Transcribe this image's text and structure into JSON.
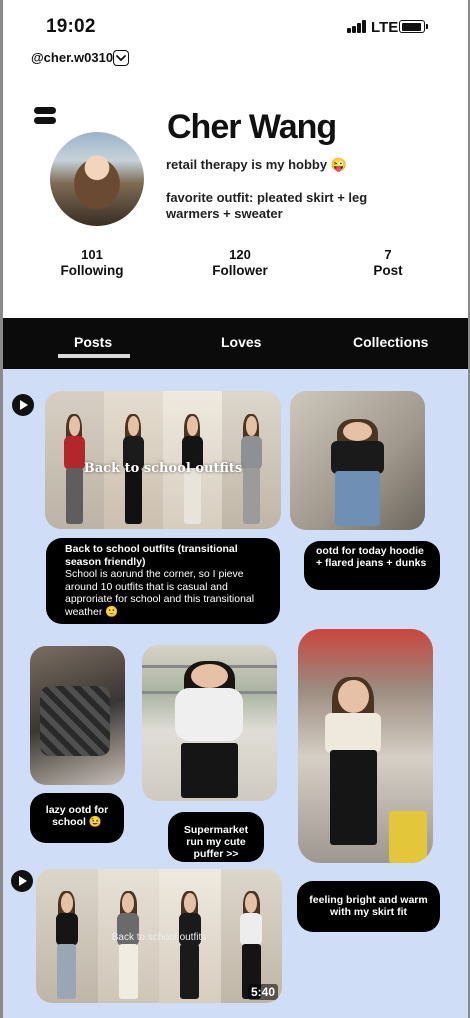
{
  "status_bar": {
    "time": "19:02",
    "network": "LTE"
  },
  "profile": {
    "handle": "@cher.w0310",
    "name": "Cher Wang",
    "bio_line1": "retail therapy is my hobby 😜",
    "bio_line2": "favorite outfit: pleated skirt + leg warmers + sweater",
    "stats": [
      {
        "value": "101",
        "label": "Following"
      },
      {
        "value": "120",
        "label": "Follower"
      },
      {
        "value": "7",
        "label": "Post"
      }
    ]
  },
  "tabs": [
    {
      "label": "Posts",
      "active": true
    },
    {
      "label": "Loves",
      "active": false
    },
    {
      "label": "Collections",
      "active": false
    }
  ],
  "posts": {
    "back_to_school": {
      "overlay": "Back to school outfits",
      "caption_title": "Back to school outfits (transitional season friendly)",
      "caption_body": "School is aorund the corner, so I pieve around 10 outfits that is casual and approriate for school and this transitional weather 🙂"
    },
    "ootd_today": {
      "caption": "ootd for today hoodie + flared jeans + dunks"
    },
    "lazy_ootd": {
      "caption": "lazy ootd for school 😉"
    },
    "supermarket": {
      "caption": "Supermarket run my cute puffer >>"
    },
    "skirt_fit": {
      "caption": "feeling bright and warm with my skirt fit"
    },
    "video_second": {
      "overlay": "Back to school outfits",
      "duration": "5:40"
    }
  },
  "colors": {
    "feed_bg": "#cfddf6",
    "tab_bar": "#0b0b0b",
    "caption_bg": "#000000"
  }
}
